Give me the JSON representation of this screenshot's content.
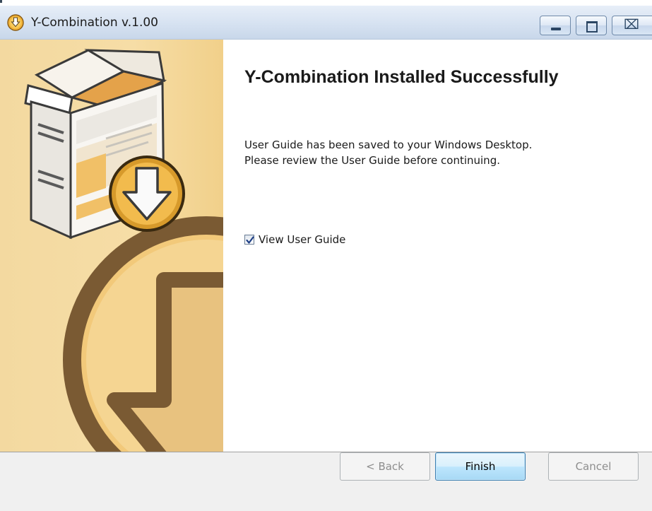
{
  "window": {
    "title": "Y-Combination v.1.00",
    "icon": "installer-download-icon",
    "controls": {
      "minimize": "minimize-icon",
      "maximize": "maximize-icon",
      "close": "close-icon",
      "close_glyph": "⌧"
    }
  },
  "side_panel": {
    "graphic": "software-box-download-illustration"
  },
  "content": {
    "heading": "Y-Combination Installed Successfully",
    "message_lines": [
      "User Guide has been saved to your Windows Desktop.",
      "Please review the User Guide before continuing."
    ],
    "checkbox": {
      "label": "View User Guide",
      "checked": true
    }
  },
  "footer": {
    "back_label": "< Back",
    "finish_label": "Finish",
    "cancel_label": "Cancel"
  },
  "colors": {
    "panel_orange": "#f6dda6",
    "accent_brown": "#7a5a33",
    "titlebar_blue": "#d6e2f1",
    "default_button_blue": "#bee6fd"
  }
}
